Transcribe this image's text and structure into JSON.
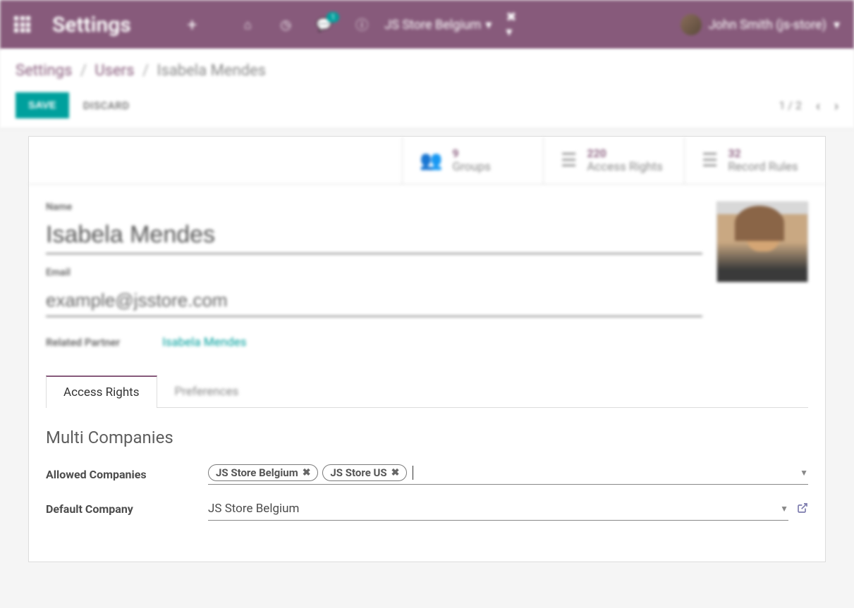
{
  "topbar": {
    "title": "Settings",
    "company": "JS Store Belgium",
    "user": "John Smith (js-store)",
    "msg_badge": "1"
  },
  "breadcrumb": {
    "root": "Settings",
    "mid": "Users",
    "leaf": "Isabela Mendes"
  },
  "actions": {
    "save": "SAVE",
    "discard": "DISCARD",
    "pager": "1 / 2"
  },
  "stats": {
    "groups": {
      "num": "9",
      "label": "Groups"
    },
    "access": {
      "num": "220",
      "label": "Access Rights"
    },
    "rules": {
      "num": "32",
      "label": "Record Rules"
    }
  },
  "form": {
    "name_label": "Name",
    "name_value": "Isabela Mendes",
    "email_label": "Email",
    "email_value": "example@jsstore.com",
    "related_label": "Related Partner",
    "related_value": "Isabela Mendes"
  },
  "tabs": {
    "access": "Access Rights",
    "prefs": "Preferences"
  },
  "multi": {
    "title": "Multi Companies",
    "allowed_label": "Allowed Companies",
    "default_label": "Default Company",
    "tags": [
      "JS Store Belgium",
      "JS Store US"
    ],
    "default_value": "JS Store Belgium"
  }
}
